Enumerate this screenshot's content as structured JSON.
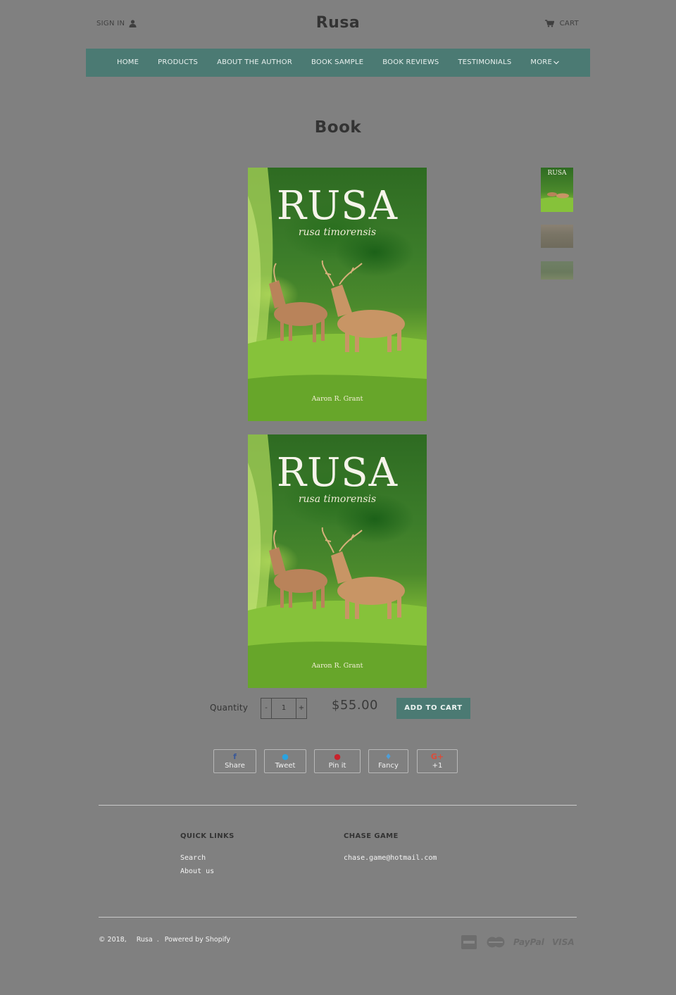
{
  "header": {
    "sign_in": "SIGN IN",
    "brand": "Rusa",
    "cart": "CART"
  },
  "nav": {
    "items": [
      "HOME",
      "PRODUCTS",
      "ABOUT THE AUTHOR",
      "BOOK SAMPLE",
      "BOOK REVIEWS",
      "TESTIMONIALS",
      "MORE"
    ]
  },
  "product": {
    "title": "Book",
    "cover": {
      "title": "RUSA",
      "subtitle": "rusa timorensis",
      "author": "Aaron R. Grant"
    },
    "thumb_label": "RUSA",
    "quantity_label": "Quantity",
    "quantity_minus": "-",
    "quantity_value": "1",
    "quantity_plus": "+",
    "price": "$55.00",
    "add_to_cart": "ADD TO CART"
  },
  "share": {
    "facebook": "Share",
    "twitter": "Tweet",
    "pinterest": "Pin it",
    "fancy": "Fancy",
    "google": "+1"
  },
  "footer": {
    "quick_links_heading": "QUICK LINKS",
    "quick_links": [
      "Search",
      "About us"
    ],
    "contact_heading": "CHASE GAME",
    "email": "chase.game@hotmail.com",
    "copyright": "© 2018,",
    "shop_name": "Rusa",
    "separator": ".",
    "powered_by": "Powered by Shopify",
    "payment_paypal": "PayPal",
    "payment_visa": "VISA"
  },
  "colors": {
    "background": "#808080",
    "accent": "#4b7a73"
  }
}
